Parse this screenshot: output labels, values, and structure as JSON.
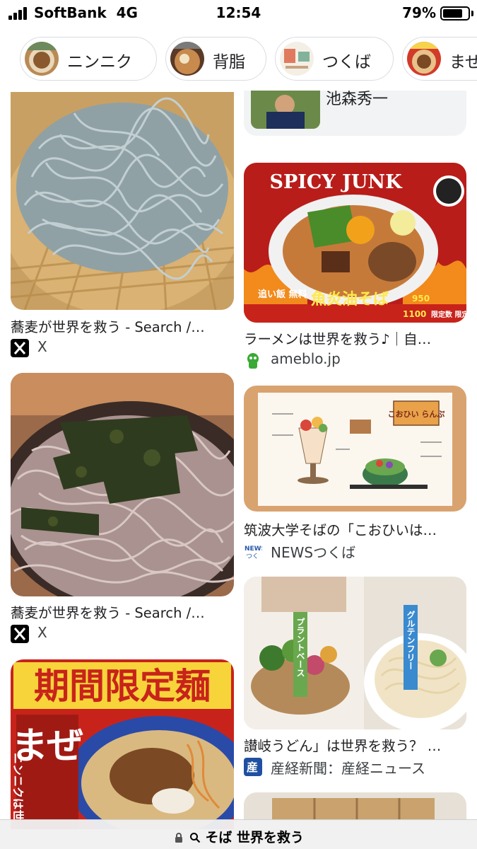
{
  "status_bar": {
    "carrier": "SoftBank",
    "network": "4G",
    "time": "12:54",
    "battery_percent": "79%",
    "battery_level": 0.79
  },
  "chips": [
    {
      "label": "ニンニク",
      "thumb": "noodle-bowl-photo"
    },
    {
      "label": "背脂",
      "thumb": "ramen-photo"
    },
    {
      "label": "つくば",
      "thumb": "menu-photo"
    },
    {
      "label": "まぜ",
      "thumb": "ramen-photo"
    }
  ],
  "results": {
    "top_partial_title": "池森秀一",
    "items": [
      {
        "title": "蕎麦が世界を救う - Search /…",
        "source": "X",
        "source_icon": "x-logo-icon"
      },
      {
        "title": "ラーメンは世界を救う♪｜自…",
        "source": "ameblo.jp",
        "source_icon": "ameblo-icon",
        "image_text": {
          "heading": "SPICY JUNK",
          "dish": "魚炎油そば",
          "price": "950",
          "set_price": "1100",
          "note_left": "追い飯 無料",
          "note_right": "限定数 限定6"
        }
      },
      {
        "title": "蕎麦が世界を救う - Search /…",
        "source": "X",
        "source_icon": "x-logo-icon"
      },
      {
        "title": "筑波大学そばの「こおひいは…",
        "source": "NEWSつくば",
        "source_icon": "news-tsukuba-icon",
        "image_text": {
          "heading": "こおひい らんぷ"
        }
      },
      {
        "title": "讃岐うどん」は世界を救う？ …",
        "source": "産経新聞：産経ニュース",
        "source_icon": "sankei-icon",
        "image_text": {
          "left_tag": "プラントベース",
          "right_tag": "グルテンフリー"
        }
      },
      {
        "title": "",
        "source": "",
        "image_text": {
          "banner": "期間限定麺",
          "main": "まぜ",
          "sub": "ニンニクは世"
        }
      }
    ]
  },
  "url_bar": {
    "query": "そば 世界を救う",
    "lock_icon": "lock-icon",
    "search_icon": "search-icon"
  },
  "colors": {
    "chip_border": "#dadce0",
    "text": "#202124",
    "ameblo_green": "#3aa935",
    "sankei_blue": "#1f4fa0"
  }
}
